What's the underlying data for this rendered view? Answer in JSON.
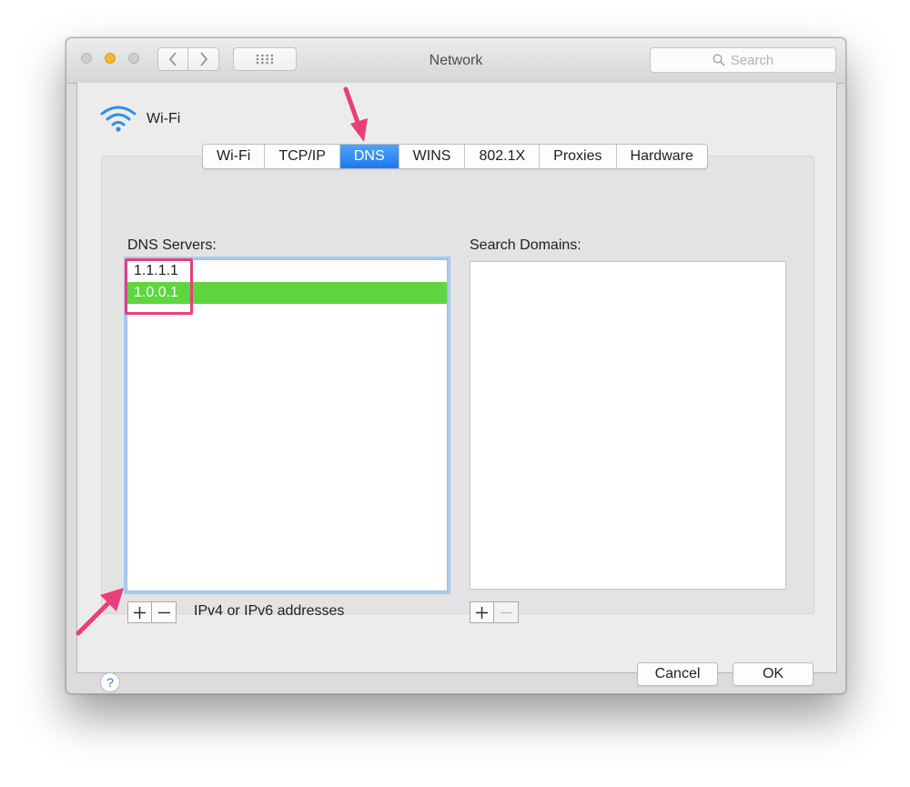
{
  "window": {
    "title": "Network",
    "search_placeholder": "Search"
  },
  "interface": {
    "name": "Wi-Fi"
  },
  "tabs": [
    {
      "label": "Wi-Fi"
    },
    {
      "label": "TCP/IP"
    },
    {
      "label": "DNS"
    },
    {
      "label": "WINS"
    },
    {
      "label": "802.1X"
    },
    {
      "label": "Proxies"
    },
    {
      "label": "Hardware"
    }
  ],
  "active_tab": "DNS",
  "dns": {
    "label": "DNS Servers:",
    "servers": [
      "1.1.1.1",
      "1.0.0.1"
    ],
    "selected": "1.0.0.1",
    "hint": "IPv4 or IPv6 addresses"
  },
  "search_domains": {
    "label": "Search Domains:",
    "entries": []
  },
  "buttons": {
    "cancel": "Cancel",
    "ok": "OK",
    "help": "?",
    "add": "+",
    "remove": "−"
  },
  "colors": {
    "accent_blue": "#2a84f2",
    "selection_green": "#5fd640",
    "annotation_pink": "#e93e7c",
    "minimize_yellow": "#f5b733"
  },
  "icons": [
    "chevron-left-icon",
    "chevron-right-icon",
    "grid-icon",
    "magnifier-icon",
    "wifi-icon",
    "annotation-arrow"
  ]
}
